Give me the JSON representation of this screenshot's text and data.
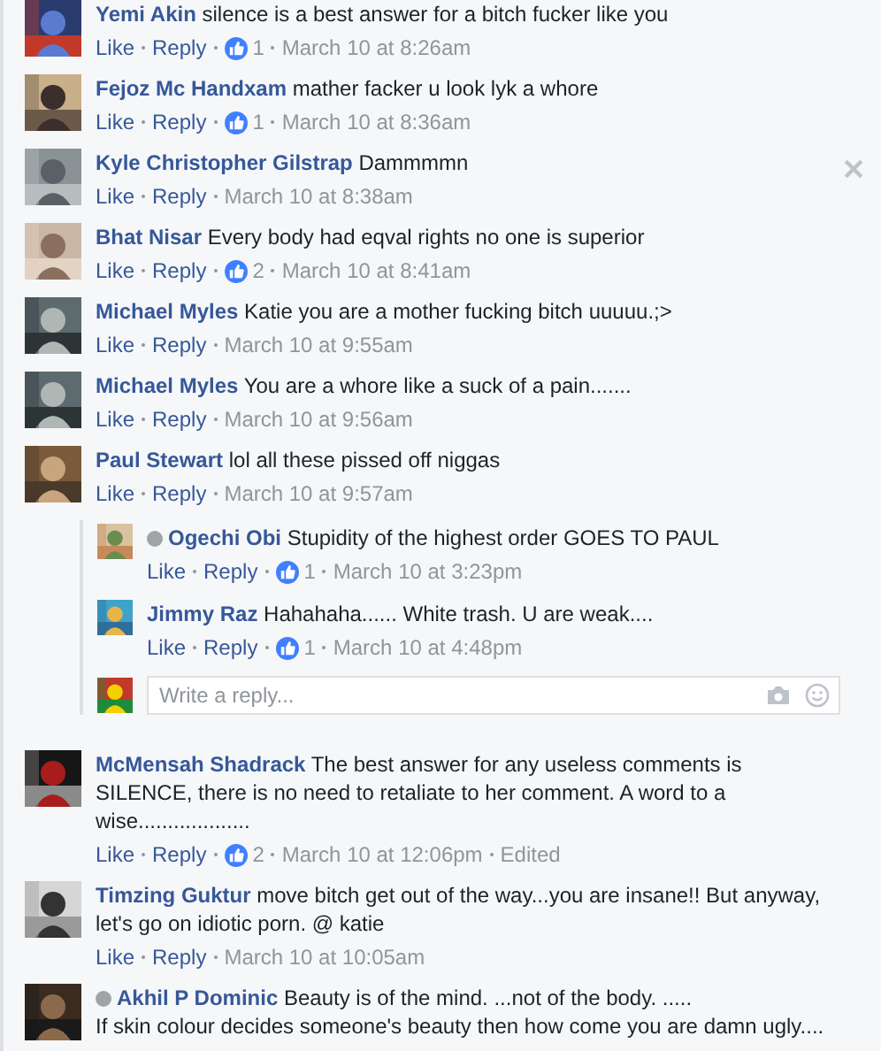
{
  "comments": [
    {
      "name": "Yemi Akin",
      "verified": false,
      "text": "silence is a best answer for a bitch fucker like you",
      "actions": [
        "Like",
        "Reply"
      ],
      "likes": "1",
      "time": "March 10 at 8:26am",
      "hovered": false
    },
    {
      "name": "Fejoz Mc Handxam",
      "verified": false,
      "text": "mather facker u look lyk a whore",
      "actions": [
        "Like",
        "Reply"
      ],
      "likes": "1",
      "time": "March 10 at 8:36am",
      "hovered": false
    },
    {
      "name": "Kyle Christopher Gilstrap",
      "verified": false,
      "text": "Dammmmn",
      "actions": [
        "Like",
        "Reply"
      ],
      "time": "March 10 at 8:38am",
      "hovered": true
    },
    {
      "name": "Bhat Nisar",
      "verified": false,
      "text": "Every body had eqval rights no one is superior",
      "actions": [
        "Like",
        "Reply"
      ],
      "likes": "2",
      "time": "March 10 at 8:41am",
      "hovered": false
    },
    {
      "name": "Michael Myles",
      "verified": false,
      "text": "Katie you are a mother fucking bitch uuuuu.;>",
      "actions": [
        "Like",
        "Reply"
      ],
      "time": "March 10 at 9:55am",
      "hovered": false
    },
    {
      "name": "Michael Myles",
      "verified": false,
      "text": "You are a whore like a suck of a pain.......",
      "actions": [
        "Like",
        "Reply"
      ],
      "time": "March 10 at 9:56am",
      "hovered": false
    },
    {
      "name": "Paul Stewart",
      "verified": false,
      "text": "lol all these pissed off niggas",
      "actions": [
        "Like",
        "Reply"
      ],
      "time": "March 10 at 9:57am",
      "hovered": false,
      "replies": [
        {
          "name": "Ogechi Obi",
          "verified": true,
          "text": "Stupidity of the highest order GOES TO PAUL",
          "actions": [
            "Like",
            "Reply"
          ],
          "likes": "1",
          "time": "March 10 at 3:23pm"
        },
        {
          "name": "Jimmy Raz",
          "verified": false,
          "text": "Hahahaha...... White trash. U are weak....",
          "actions": [
            "Like",
            "Reply"
          ],
          "likes": "1",
          "time": "March 10 at 4:48pm"
        }
      ],
      "reply_box": {
        "placeholder": "Write a reply..."
      }
    },
    {
      "name": "McMensah Shadrack",
      "verified": false,
      "text": "The best answer for any useless comments is SILENCE, there is no need to retaliate to her comment. A word to a wise...................",
      "actions": [
        "Like",
        "Reply"
      ],
      "likes": "2",
      "time": "March 10 at 12:06pm",
      "edited": "Edited",
      "hovered": false
    },
    {
      "name": "Timzing Guktur",
      "verified": false,
      "text": "move bitch get out of the way...you are insane!! But anyway, let's go on idiotic porn. @ katie",
      "actions": [
        "Like",
        "Reply"
      ],
      "time": "March 10 at 10:05am",
      "hovered": false
    },
    {
      "name": "Akhil P Dominic",
      "verified": true,
      "text": "Beauty is of the mind. ...not of the body. .....\nIf skin colour decides someone's beauty then how come you are damn ugly....",
      "hovered": false
    }
  ]
}
